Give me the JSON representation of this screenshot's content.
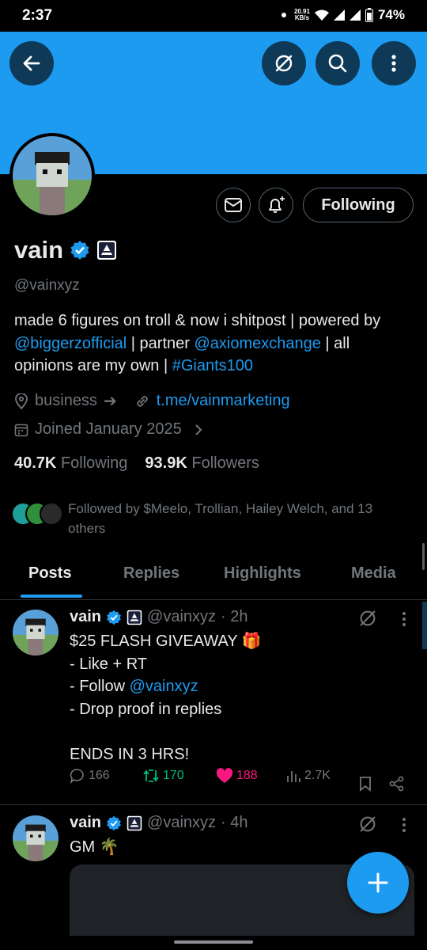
{
  "status": {
    "time": "2:37",
    "net_speed_value": "20.91",
    "net_speed_unit": "KB/s",
    "battery": "74%"
  },
  "profile": {
    "name": "vain",
    "handle": "@vainxyz",
    "following_button": "Following",
    "bio": {
      "p1": "made 6 figures on troll & now i shitpost | powered by ",
      "link1": "@biggerzofficial",
      "p2": " | partner ",
      "link2": "@axiomexchange",
      "p3": " | all opinions are my own | ",
      "link3": "#Giants100"
    },
    "category": "business",
    "category_arrow": "➔",
    "website": "t.me/vainmarketing",
    "joined": "Joined January 2025",
    "following_count": "40.7K",
    "following_label": "Following",
    "followers_count": "93.9K",
    "followers_label": "Followers",
    "followed_by": "Followed by $Meelo, Trollian, Hailey Welch, and 13 others"
  },
  "tabs": [
    "Posts",
    "Replies",
    "Highlights",
    "Media"
  ],
  "tweets": [
    {
      "name": "vain",
      "handle": "@vainxyz",
      "time": "· 2h",
      "line1": "$25 FLASH GIVEAWAY 🎁",
      "line2": "- Like + RT",
      "line3_pre": "- Follow ",
      "line3_link": "@vainxyz",
      "line4": "- Drop proof in replies",
      "line5": "ENDS IN 3 HRS!",
      "replies": "166",
      "retweets": "170",
      "likes": "188",
      "views": "2.7K"
    },
    {
      "name": "vain",
      "handle": "@vainxyz",
      "time": "· 4h",
      "text": "GM 🌴"
    }
  ],
  "colors": {
    "accent": "#1d9bf0",
    "retweet": "#00ba7c",
    "like": "#f91880",
    "banner": "#1d9bf0"
  }
}
